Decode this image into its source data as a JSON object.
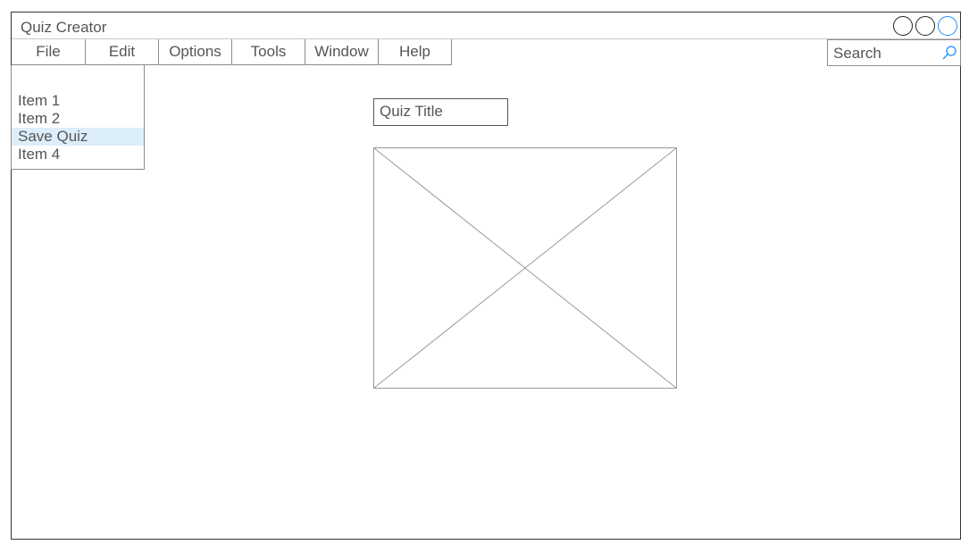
{
  "window": {
    "title": "Quiz Creator"
  },
  "menubar": {
    "items": [
      {
        "label": "File"
      },
      {
        "label": "Edit"
      },
      {
        "label": "Options"
      },
      {
        "label": "Tools"
      },
      {
        "label": "Window"
      },
      {
        "label": "Help"
      }
    ]
  },
  "search": {
    "placeholder": "Search",
    "icon": "search-icon",
    "icon_color": "#1e90ff"
  },
  "dropdown": {
    "items": [
      {
        "label": "Item 1"
      },
      {
        "label": "Item 2"
      },
      {
        "label": "Save Quiz",
        "selected": true
      },
      {
        "label": "Item 4"
      }
    ],
    "highlight_color": "#ddeefb"
  },
  "main": {
    "quiz_title": "Quiz Title",
    "image_placeholder": "image-placeholder"
  },
  "colors": {
    "active_control": "#1e90ff"
  }
}
